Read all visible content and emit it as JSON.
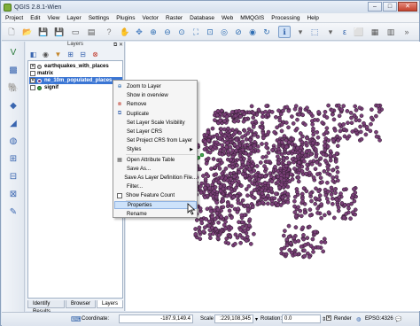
{
  "window": {
    "title": "QGIS 2.8.1-Wien"
  },
  "menubar": [
    "Project",
    "Edit",
    "View",
    "Layer",
    "Settings",
    "Plugins",
    "Vector",
    "Raster",
    "Database",
    "Web",
    "MMQGIS",
    "Processing",
    "Help"
  ],
  "layers_panel": {
    "title": "Layers",
    "layers": [
      {
        "name": "earthquakes_with_places",
        "checked": true
      },
      {
        "name": "matrix",
        "checked": false
      },
      {
        "name": "ne_10m_populated_places",
        "checked": true,
        "selected": true
      },
      {
        "name": "signif",
        "checked": false
      }
    ],
    "tabs": [
      "Identify Results",
      "Browser",
      "Layers"
    ],
    "active_tab": "Layers"
  },
  "context_menu": {
    "items": [
      {
        "label": "Zoom to Layer",
        "icon": "zoom-icon"
      },
      {
        "label": "Show in overview",
        "icon": "none"
      },
      {
        "label": "Remove",
        "icon": "remove-icon"
      },
      {
        "label": "Duplicate",
        "icon": "duplicate-icon"
      },
      {
        "label": "Set Layer Scale Visibility",
        "icon": "none"
      },
      {
        "label": "Set Layer CRS",
        "icon": "none"
      },
      {
        "label": "Set Project CRS from Layer",
        "icon": "none"
      },
      {
        "label": "Styles",
        "icon": "none",
        "submenu": true
      },
      {
        "label": "Open Attribute Table",
        "icon": "table-icon"
      },
      {
        "label": "Save As...",
        "icon": "none"
      },
      {
        "label": "Save As Layer Definition File...",
        "icon": "none"
      },
      {
        "label": "Filter...",
        "icon": "none"
      },
      {
        "label": "Show Feature Count",
        "icon": "none"
      },
      {
        "label": "Properties",
        "icon": "none",
        "active": true
      },
      {
        "label": "Rename",
        "icon": "none"
      }
    ]
  },
  "statusbar": {
    "coordinate_label": "Coordinate:",
    "coordinate_value": "-187.9,149.4",
    "scale_label": "Scale",
    "scale_value": ":229,108,345",
    "rotation_label": "Rotation:",
    "rotation_value": "0.0",
    "render_label": "Render",
    "crs_value": "EPSG:4326"
  },
  "colors": {
    "point_fill": "#7a3f78",
    "point_stroke": "#2a1a2a",
    "selection": "#3b76d4"
  }
}
